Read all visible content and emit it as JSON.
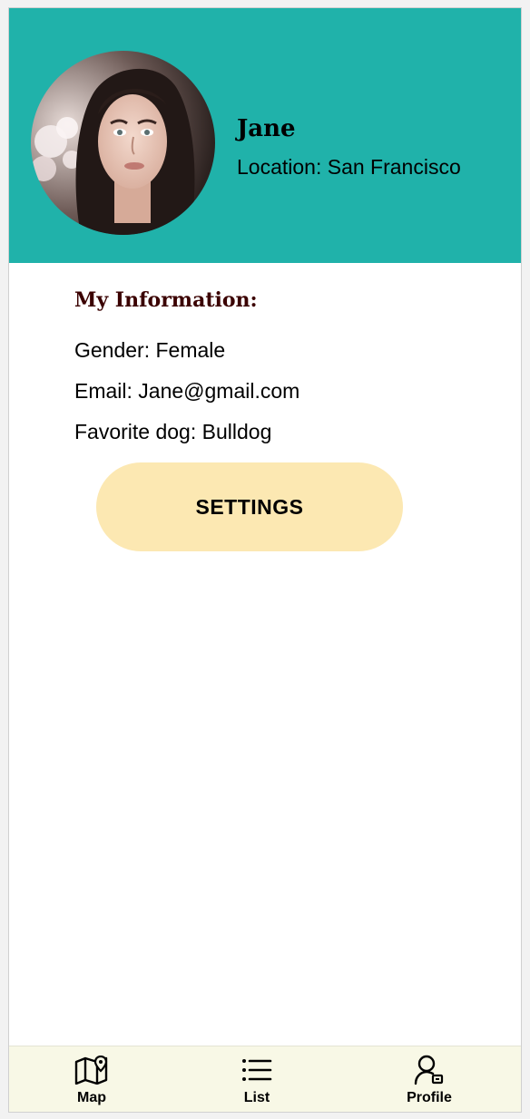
{
  "profile": {
    "name": "Jane",
    "location": "Location: San Francisco"
  },
  "info": {
    "title": "My Information:",
    "gender": "Gender: Female",
    "email": "Email: Jane@gmail.com",
    "favorite_dog": "Favorite dog: Bulldog"
  },
  "actions": {
    "settings_label": "SETTINGS"
  },
  "tabbar": {
    "items": [
      {
        "label": "Map",
        "icon": "map-icon"
      },
      {
        "label": "List",
        "icon": "list-icon"
      },
      {
        "label": "Profile",
        "icon": "profile-icon"
      }
    ]
  },
  "colors": {
    "header": "#20b2aa",
    "button": "#fce8b2",
    "tabbar": "#f8f8e6",
    "section_title": "#3a0000"
  }
}
